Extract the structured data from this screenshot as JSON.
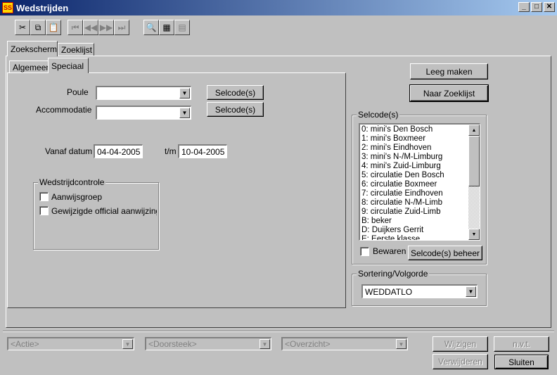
{
  "window": {
    "title": "Wedstrijden",
    "icon_text": "SS",
    "minimize": "_",
    "maximize": "□",
    "close": "✕"
  },
  "toolbar": [
    {
      "name": "cut-icon",
      "glyph": "✂",
      "disabled": false
    },
    {
      "name": "copy-icon",
      "glyph": "⧉",
      "disabled": false
    },
    {
      "name": "paste-icon",
      "glyph": "📋",
      "disabled": false
    },
    {
      "name": "first-record-icon",
      "glyph": "⏮",
      "disabled": true
    },
    {
      "name": "previous-record-icon",
      "glyph": "◀◀",
      "disabled": true
    },
    {
      "name": "next-record-icon",
      "glyph": "▶▶",
      "disabled": true
    },
    {
      "name": "last-record-icon",
      "glyph": "⏭",
      "disabled": true
    },
    {
      "name": "search-icon",
      "glyph": "🔍",
      "disabled": false
    },
    {
      "name": "table-view-icon",
      "glyph": "▦",
      "disabled": false
    },
    {
      "name": "form-view-icon",
      "glyph": "▤",
      "disabled": true
    }
  ],
  "tabs": {
    "outer": [
      "Zoekscherm",
      "Zoeklijst"
    ],
    "inner": [
      "Algemeen",
      "Speciaal"
    ]
  },
  "form": {
    "poule_label": "Poule",
    "accommodatie_label": "Accommodatie",
    "selcode_button": "Selcode(s)",
    "vanaf_label": "Vanaf datum",
    "vanaf_value": "04-04-2005",
    "tm_label": "t/m",
    "tm_value": "10-04-2005"
  },
  "wedstrijdcontrole": {
    "title": "Wedstrijdcontrole",
    "aanwijsgroep": "Aanwijsgroep",
    "gewijzigde": "Gewijzigde official aanwijzing"
  },
  "right": {
    "leeg_maken": "Leeg maken",
    "naar_zoeklijst": "Naar Zoeklijst",
    "selcodes_title": "Selcode(s)",
    "selcodes": [
      "0: mini's Den Bosch",
      "1: mini's Boxmeer",
      "2: mini's Eindhoven",
      "3: mini's N-/M-Limburg",
      "4: mini's Zuid-Limburg",
      "5: circulatie Den Bosch",
      "6: circulatie Boxmeer",
      "7: circulatie Eindhoven",
      "8: circulatie N-/M-Limb",
      "9: circulatie Zuid-Limb",
      "B: beker",
      "D: Duijkers Gerrit",
      "E: Eerste klasse"
    ],
    "bewaren": "Bewaren",
    "selcode_beheer": "Selcode(s) beheer",
    "sortering_title": "Sortering/Volgorde",
    "sortering_value": "WEDDATLO"
  },
  "bottom": {
    "actie": "<Actie>",
    "doorsteek": "<Doorsteek>",
    "overzicht": "<Overzicht>",
    "wijzigen": "Wijzigen",
    "nvt": "n.v.t.",
    "verwijderen": "Verwijderen",
    "sluiten": "Sluiten"
  }
}
